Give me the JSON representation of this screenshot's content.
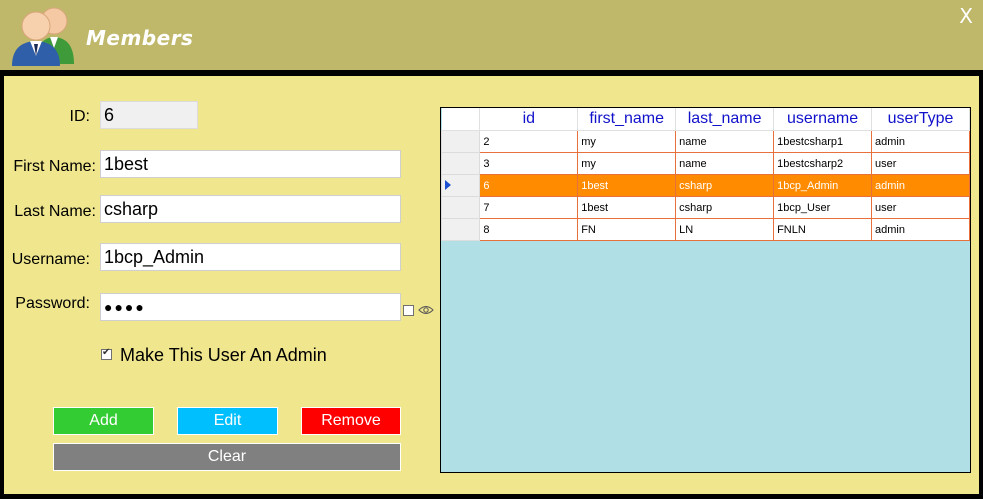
{
  "window": {
    "title": "Members",
    "close_label": "X"
  },
  "form": {
    "id": {
      "label": "ID:",
      "value": "6"
    },
    "first_name": {
      "label": "First Name:",
      "value": "1best"
    },
    "last_name": {
      "label": "Last Name:",
      "value": "csharp"
    },
    "username": {
      "label": "Username:",
      "value": "1bcp_Admin"
    },
    "password": {
      "label": "Password:",
      "value": "●●●●",
      "show_password_checked": false
    },
    "admin_checkbox": {
      "label": "Make This User An Admin",
      "checked": true
    }
  },
  "buttons": {
    "add": "Add",
    "edit": "Edit",
    "remove": "Remove",
    "clear": "Clear"
  },
  "colors": {
    "add": "#33cc33",
    "edit": "#00bfff",
    "remove": "#ff0000",
    "clear": "#808080",
    "selected_row": "#ff8c00",
    "grid_background": "#b0e0e6"
  },
  "grid": {
    "columns": [
      "id",
      "first_name",
      "last_name",
      "username",
      "userType"
    ],
    "rows": [
      [
        "2",
        "my",
        "name",
        "1bestcsharp1",
        "admin"
      ],
      [
        "3",
        "my",
        "name",
        "1bestcsharp2",
        "user"
      ],
      [
        "6",
        "1best",
        "csharp",
        "1bcp_Admin",
        "admin"
      ],
      [
        "7",
        "1best",
        "csharp",
        "1bcp_User",
        "user"
      ],
      [
        "8",
        "FN",
        "LN",
        "FNLN",
        "admin"
      ]
    ],
    "selected_index": 2
  }
}
